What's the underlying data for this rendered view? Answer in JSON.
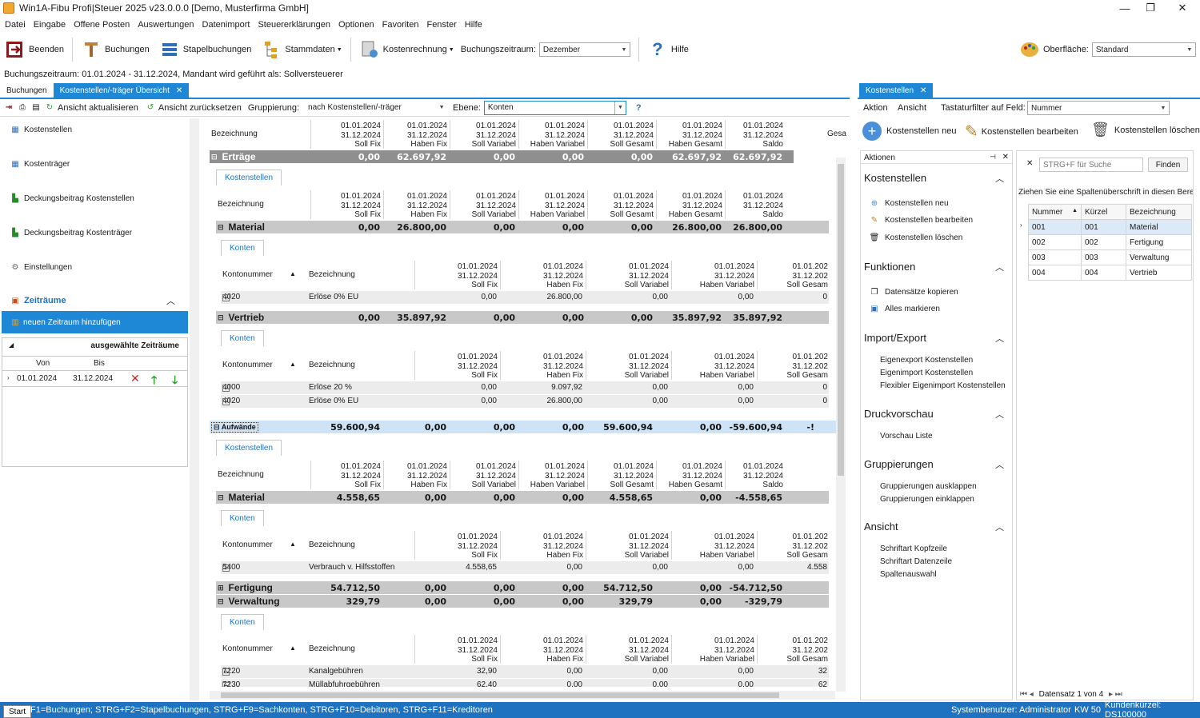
{
  "window": {
    "title": "Win1A-Fibu Profi|Steuer 2025 v23.0.0.0 [Demo, Musterfirma GmbH]",
    "controls": {
      "minimize": "—",
      "maximize": "❐",
      "close": "✕"
    }
  },
  "menu": [
    "Datei",
    "Eingabe",
    "Offene Posten",
    "Auswertungen",
    "Datenimport",
    "Steuererklärungen",
    "Optionen",
    "Favoriten",
    "Fenster",
    "Hilfe"
  ],
  "toolbar": {
    "beenden": "Beenden",
    "buchungen": "Buchungen",
    "stapel": "Stapelbuchungen",
    "stammdaten": "Stammdaten",
    "kostenrechnung": "Kostenrechnung",
    "zeitraum_label": "Buchungszeitraum:",
    "zeitraum_value": "Dezember",
    "hilfe": "Hilfe",
    "oberflaeche_label": "Oberfläche:",
    "oberflaeche_value": "Standard"
  },
  "info_line": "Buchungszeitraum: 01.01.2024 - 31.12.2024, Mandant wird geführt als: Sollversteuerer",
  "doc_tabs": [
    {
      "label": "Buchungen"
    },
    {
      "label": "Kostenstellen/-träger Übersicht"
    }
  ],
  "doc_toolbar": {
    "refresh": "Ansicht aktualisieren",
    "reset": "Ansicht zurücksetzen",
    "grouping_label": "Gruppierung:",
    "grouping_value": "nach Kostenstellen/-träger",
    "level_label": "Ebene:",
    "level_value": "Konten",
    "help_icon": "?"
  },
  "nav": {
    "items": [
      "Kostenstellen",
      "Kostenträger",
      "Deckungsbeitrag Kostenstellen",
      "Deckungsbeitrag Kostenträger",
      "Einstellungen"
    ],
    "zeitraeume_header": "Zeiträume",
    "add_period": "neuen Zeitraum hinzufügen",
    "selected_header": "ausgewählte Zeiträume",
    "col_von": "Von",
    "col_bis": "Bis",
    "period_von": "01.01.2024",
    "period_bis": "31.12.2024"
  },
  "grid": {
    "col_headers": [
      [
        "01.01.2024",
        "31.12.2024",
        "Soll Fix"
      ],
      [
        "01.01.2024",
        "31.12.2024",
        "Haben Fix"
      ],
      [
        "01.01.2024",
        "31.12.2024",
        "Soll Variabel"
      ],
      [
        "01.01.2024",
        "31.12.2024",
        "Haben Variabel"
      ],
      [
        "01.01.2024",
        "31.12.2024",
        "Soll Gesamt"
      ],
      [
        "01.01.2024",
        "31.12.2024",
        "Haben Gesamt"
      ],
      [
        "01.01.2024",
        "31.12.2024",
        "Saldo"
      ]
    ],
    "konto_col_headers": [
      [
        "01.01.2024",
        "31.12.2024",
        "Soll Fix"
      ],
      [
        "01.01.2024",
        "31.12.2024",
        "Haben Fix"
      ],
      [
        "01.01.2024",
        "31.12.2024",
        "Soll Variabel"
      ],
      [
        "01.01.2024",
        "31.12.2024",
        "Haben Variabel"
      ],
      [
        "01.01.202",
        "31.12.202",
        "Soll Gesam"
      ]
    ],
    "bezeichnung": "Bezeichnung",
    "kontonummer": "Kontonummer",
    "gesamt_cut": "Gesar",
    "tab_kostenstellen": "Kostenstellen",
    "tab_konten": "Konten",
    "ertraege": {
      "label": "Erträge",
      "values": [
        "0,00",
        "62.697,92",
        "0,00",
        "0,00",
        "0,00",
        "62.697,92",
        "62.697,92"
      ]
    },
    "material_e": {
      "label": "Material",
      "values": [
        "0,00",
        "26.800,00",
        "0,00",
        "0,00",
        "0,00",
        "26.800,00",
        "26.800,00"
      ]
    },
    "konto_4020a": {
      "nr": "4020",
      "bez": "Erlöse 0% EU",
      "values": [
        "0,00",
        "26.800,00",
        "0,00",
        "0,00",
        "0"
      ]
    },
    "vertrieb": {
      "label": "Vertrieb",
      "values": [
        "0,00",
        "35.897,92",
        "0,00",
        "0,00",
        "0,00",
        "35.897,92",
        "35.897,92"
      ]
    },
    "konto_4000": {
      "nr": "4000",
      "bez": "Erlöse 20 %",
      "values": [
        "0,00",
        "9.097,92",
        "0,00",
        "0,00",
        "0"
      ]
    },
    "konto_4020b": {
      "nr": "4020",
      "bez": "Erlöse 0% EU",
      "values": [
        "0,00",
        "26.800,00",
        "0,00",
        "0,00",
        "0"
      ]
    },
    "aufwaende": {
      "label": "Aufwände",
      "values": [
        "59.600,94",
        "0,00",
        "0,00",
        "0,00",
        "59.600,94",
        "0,00",
        "-59.600,94",
        "-!"
      ]
    },
    "material_a": {
      "label": "Material",
      "values": [
        "4.558,65",
        "0,00",
        "0,00",
        "0,00",
        "4.558,65",
        "0,00",
        "-4.558,65"
      ]
    },
    "konto_5400": {
      "nr": "5400",
      "bez": "Verbrauch v. Hilfsstoffen",
      "values": [
        "4.558,65",
        "0,00",
        "0,00",
        "0,00",
        "4.558"
      ]
    },
    "fertigung": {
      "label": "Fertigung",
      "values": [
        "54.712,50",
        "0,00",
        "0,00",
        "0,00",
        "54.712,50",
        "0,00",
        "-54.712,50"
      ]
    },
    "verwaltung": {
      "label": "Verwaltung",
      "values": [
        "329,79",
        "0,00",
        "0,00",
        "0,00",
        "329,79",
        "0,00",
        "-329,79"
      ]
    },
    "konto_7220": {
      "nr": "7220",
      "bez": "Kanalgebühren",
      "values": [
        "32,90",
        "0,00",
        "0,00",
        "0,00",
        "32"
      ]
    },
    "konto_7230": {
      "nr": "7230",
      "bez": "Müllabfuhrgebühren",
      "values": [
        "62,40",
        "0,00",
        "0,00",
        "0,00",
        "62"
      ]
    }
  },
  "right": {
    "tab": "Kostenstellen",
    "menu_aktion": "Aktion",
    "menu_ansicht": "Ansicht",
    "filter_label": "Tastaturfilter auf Feld:",
    "filter_value": "Nummer",
    "btn_new": "Kostenstellen neu",
    "btn_edit": "Kostenstellen bearbeiten",
    "btn_delete": "Kostenstellen löschen",
    "actions_title": "Aktionen",
    "sections": {
      "kostenstellen": {
        "title": "Kostenstellen",
        "items": [
          "Kostenstellen neu",
          "Kostenstellen bearbeiten",
          "Kostenstellen löschen"
        ]
      },
      "funktionen": {
        "title": "Funktionen",
        "items": [
          "Datensätze kopieren",
          "Alles markieren"
        ]
      },
      "import": {
        "title": "Import/Export",
        "items": [
          "Eigenexport Kostenstellen",
          "Eigenimport Kostenstellen",
          "Flexibler Eigenimport Kostenstellen"
        ]
      },
      "druck": {
        "title": "Druckvorschau",
        "items": [
          "Vorschau Liste"
        ]
      },
      "gruppierungen": {
        "title": "Gruppierungen",
        "items": [
          "Gruppierungen ausklappen",
          "Gruppierungen einklappen"
        ]
      },
      "ansicht": {
        "title": "Ansicht",
        "items": [
          "Schriftart Kopfzeile",
          "Schriftart Datenzeile",
          "Spaltenauswahl"
        ]
      }
    },
    "search_placeholder": "STRG+F für Suche",
    "search_button": "Finden",
    "group_hint": "Ziehen Sie eine Spaltenüberschrift in diesen Bereich",
    "columns": [
      "Nummer",
      "Kürzel",
      "Bezeichnung"
    ],
    "rows": [
      [
        "001",
        "001",
        "Material"
      ],
      [
        "002",
        "002",
        "Fertigung"
      ],
      [
        "003",
        "003",
        "Verwaltung"
      ],
      [
        "004",
        "004",
        "Vertrieb"
      ]
    ],
    "pager": "Datensatz 1 von 4"
  },
  "statusbar": {
    "start": "Start",
    "hint": "F1=Buchungen; STRG+F2=Stapelbuchungen, STRG+F9=Sachkonten, STRG+F10=Debitoren, STRG+F11=Kreditoren",
    "user": "Systembenutzer: Administrator",
    "kw": "KW 50",
    "kunde": "Kundenkürzel: DS100000"
  },
  "colors": {
    "accent": "#1e88d6",
    "status": "#1e72c0",
    "group_dark": "#8f8f8f"
  }
}
